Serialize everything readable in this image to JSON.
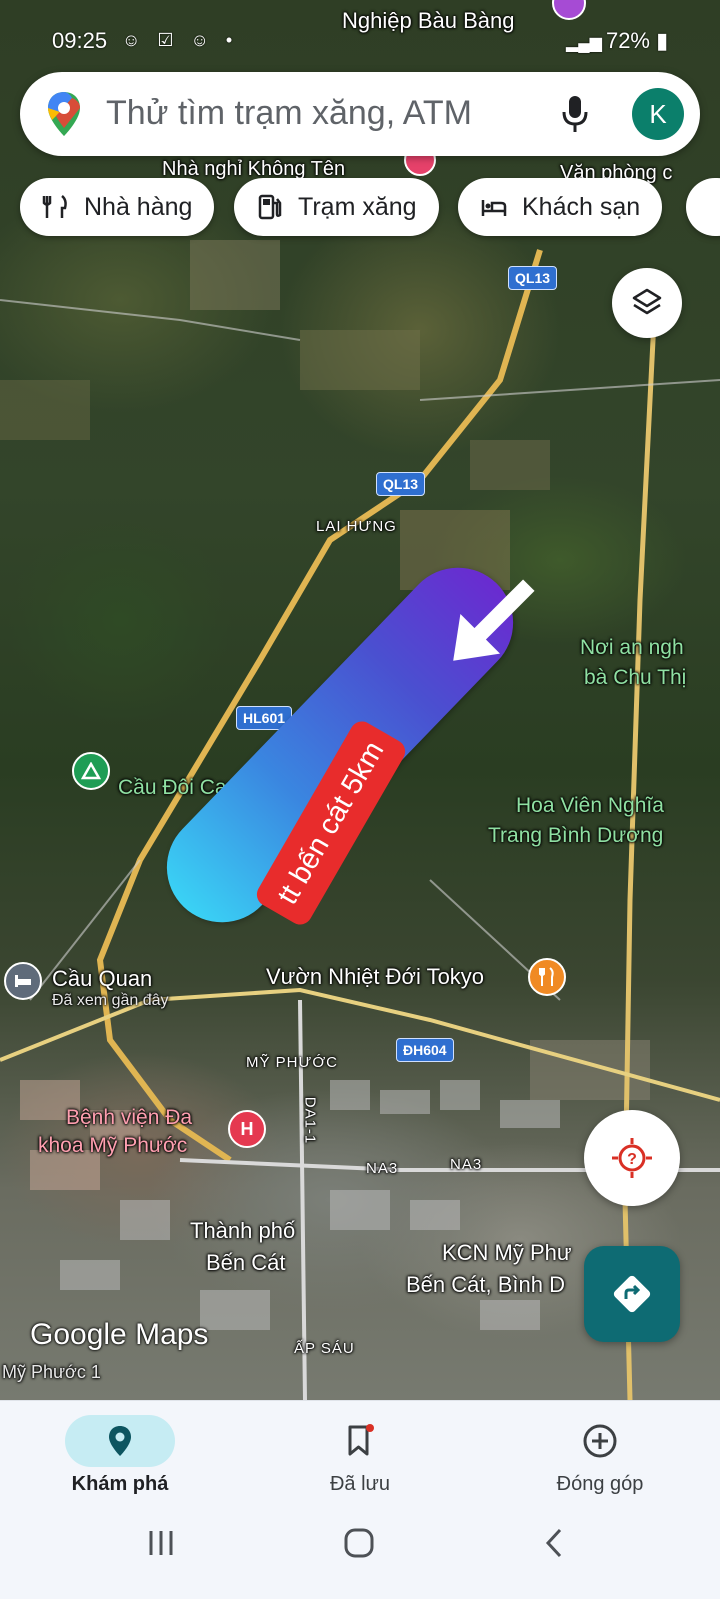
{
  "status_bar": {
    "time": "09:25",
    "battery": "72%"
  },
  "search": {
    "placeholder": "Thử tìm trạm xăng, ATM",
    "avatar_letter": "K"
  },
  "chips": [
    {
      "label": "Nhà hàng",
      "icon": "fork-knife-icon"
    },
    {
      "label": "Trạm xăng",
      "icon": "gas-pump-icon"
    },
    {
      "label": "Khách sạn",
      "icon": "bed-icon"
    }
  ],
  "map": {
    "labels": {
      "bau_bang": "Nghiệp Bàu Bàng",
      "nha_nghi": "Nhà nghỉ Không Tên",
      "van_phong": "Văn phòng c",
      "lai_hung": "LAI HƯNG",
      "noi_an_nghi_1": "Nơi an ngh",
      "noi_an_nghi_2": "bà Chu Thị",
      "cau_doi": "Cầu Đôi Camp",
      "hoa_vien_1": "Hoa Viên Nghĩa",
      "hoa_vien_2": "Trang Bình Dương",
      "cau_quan": "Cầu Quan",
      "da_xem": "Đã xem gần đây",
      "vuon": "Vườn Nhiệt Đới Tokyo",
      "my_phuoc": "MỸ PHƯỚC",
      "benh_vien_1": "Bệnh viện Đa",
      "benh_vien_2": "khoa Mỹ Phước",
      "thanh_pho_1": "Thành phố",
      "thanh_pho_2": "Bến Cát",
      "kcn_1": "KCN Mỹ Phư",
      "kcn_2": "Bến Cát, Bình D",
      "ap_sau": "ẤP SÁU",
      "my_phuoc_1": "Mỹ Phước 1",
      "na3_a": "NA3",
      "na3_b": "NA3",
      "da1": "DA1-1"
    },
    "shields": {
      "ql13_top": "QL13",
      "ql13_mid": "QL13",
      "hl601": "HL601",
      "dh604": "ĐH604"
    },
    "banner_text": "tt bến cát 5km",
    "attribution": "Google Maps"
  },
  "bottom_nav": [
    {
      "label": "Khám phá",
      "active": true
    },
    {
      "label": "Đã lưu",
      "active": false
    },
    {
      "label": "Đóng góp",
      "active": false
    }
  ],
  "colors": {
    "accent": "#0e6b73",
    "avatar": "#0b7f6b",
    "banner_tag": "#e82c2c"
  }
}
